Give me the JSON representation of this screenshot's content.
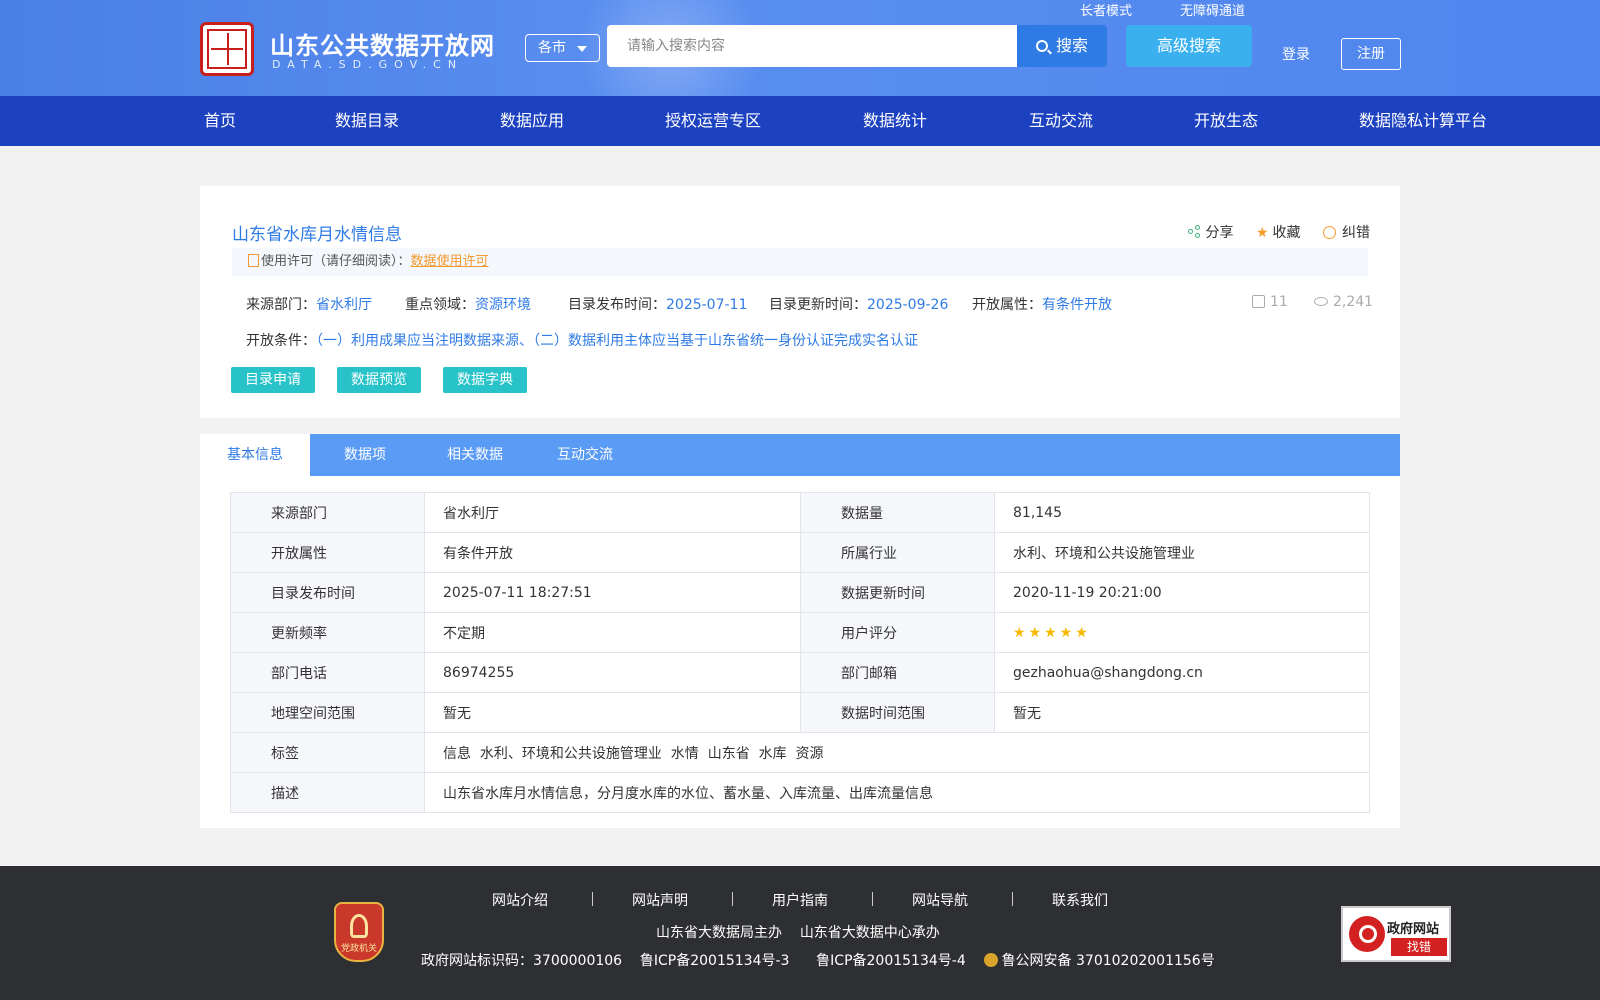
{
  "header": {
    "site_title": "山东公共数据开放网",
    "site_domain": "DATA.SD.GOV.CN",
    "elder_mode": "长者模式",
    "accessible": "无障碍通道",
    "city_select": "各市",
    "search_placeholder": "请输入搜索内容",
    "search_label": "搜索",
    "advanced_search": "高级搜索",
    "login": "登录",
    "register": "注册"
  },
  "nav": [
    "首页",
    "数据目录",
    "数据应用",
    "授权运营专区",
    "数据统计",
    "互动交流",
    "开放生态",
    "数据隐私计算平台"
  ],
  "dataset": {
    "title": "山东省水库月水情信息",
    "share": "分享",
    "favorite": "收藏",
    "report_error": "纠错",
    "license_prefix": "使用许可（请仔细阅读）：",
    "license_link": "数据使用许可",
    "source_label": "来源部门：",
    "source_value": "省水利厅",
    "domain_label": "重点领域：",
    "domain_value": "资源环境",
    "publish_label": "目录发布时间：",
    "publish_value": "2025-07-11",
    "update_label": "目录更新时间：",
    "update_value": "2025-09-26",
    "open_label": "开放属性：",
    "open_value": "有条件开放",
    "downloads": "11",
    "views": "2,241",
    "condition_label": "开放条件：",
    "condition_value": "（一）利用成果应当注明数据来源、（二）数据利用主体应当基于山东省统一身份认证完成实名认证",
    "btn_apply": "目录申请",
    "btn_preview": "数据预览",
    "btn_dict": "数据字典"
  },
  "tabs": [
    "基本信息",
    "数据项",
    "相关数据",
    "互动交流"
  ],
  "info_table": {
    "rows": [
      {
        "l1": "来源部门",
        "v1": "省水利厅",
        "l2": "数据量",
        "v2": "81,145"
      },
      {
        "l1": "开放属性",
        "v1": "有条件开放",
        "l2": "所属行业",
        "v2": "水利、环境和公共设施管理业"
      },
      {
        "l1": "目录发布时间",
        "v1": "2025-07-11 18:27:51",
        "l2": "数据更新时间",
        "v2": "2020-11-19 20:21:00"
      },
      {
        "l1": "更新频率",
        "v1": "不定期",
        "l2": "用户评分",
        "v2": ""
      },
      {
        "l1": "部门电话",
        "v1": "86974255",
        "l2": "部门邮箱",
        "v2": "gezhaohua@shangdong.cn"
      },
      {
        "l1": "地理空间范围",
        "v1": "暂无",
        "l2": "数据时间范围",
        "v2": "暂无"
      }
    ],
    "rating_stars": 5,
    "tags_label": "标签",
    "tags_value": "信息  水利、环境和公共设施管理业  水情  山东省  水库  资源",
    "desc_label": "描述",
    "desc_value": "山东省水库月水情信息，分月度水库的水位、蓄水量、入库流量、出库流量信息"
  },
  "footer": {
    "links": [
      "网站介绍",
      "网站声明",
      "用户指南",
      "网站导航",
      "联系我们"
    ],
    "host": "山东省大数据局主办",
    "undertaker": "山东省大数据中心承办",
    "site_id": "政府网站标识码：3700000106",
    "icp1": "鲁ICP备20015134号-3",
    "icp2": "鲁ICP备20015134号-4",
    "police": "鲁公网安备 37010202001156号",
    "party_badge": "党政机关",
    "gov_badge_title": "政府网站",
    "gov_badge_sub": "找错"
  },
  "colors": {
    "header_bg": "#4f86ee",
    "nav_bg": "#1d42c1",
    "accent": "#2f7be6",
    "teal_button": "#27c3c8",
    "tab_bar": "#5a9bf5",
    "footer_bg": "#2e2f33"
  }
}
